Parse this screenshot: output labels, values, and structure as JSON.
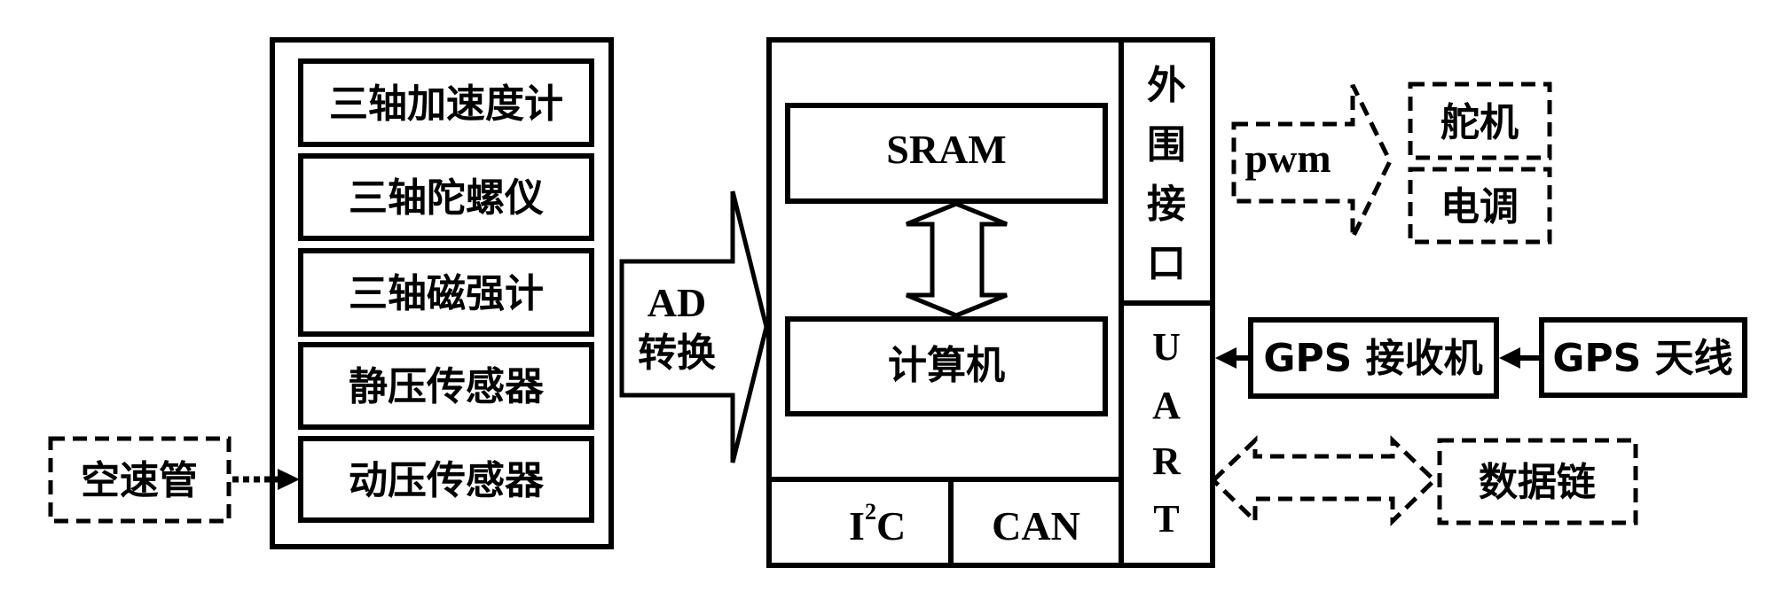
{
  "diagram": {
    "sensor_module": {
      "sensors": [
        {
          "label": "三轴加速度计"
        },
        {
          "label": "三轴陀螺仪"
        },
        {
          "label": "三轴磁强计"
        },
        {
          "label": "静压传感器"
        },
        {
          "label": "动压传感器"
        }
      ]
    },
    "pitot_tube": {
      "label": "空速管"
    },
    "ad_converter": {
      "line1": "AD",
      "line2": "转换"
    },
    "computer_module": {
      "sram": {
        "label": "SRAM"
      },
      "cpu": {
        "label": "计算机"
      },
      "i2c": {
        "base": "I",
        "superscript": "2",
        "suffix": "C"
      },
      "can": {
        "label": "CAN"
      },
      "peripheral_interface": {
        "chars": [
          "外",
          "围",
          "接",
          "口"
        ]
      },
      "uart": {
        "chars": [
          "U",
          "A",
          "R",
          "T"
        ]
      }
    },
    "pwm": {
      "label": "pwm"
    },
    "servo": {
      "label": "舵机"
    },
    "esc": {
      "label": "电调"
    },
    "gps_receiver": {
      "label": "GPS 接收机"
    },
    "gps_antenna": {
      "label": "GPS 天线"
    },
    "data_link": {
      "label": "数据链"
    }
  }
}
